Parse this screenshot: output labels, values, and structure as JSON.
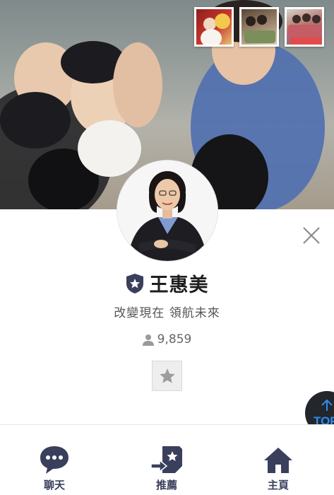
{
  "cover": {
    "photos": [
      {
        "icon": "event-photo-icon"
      },
      {
        "icon": "event-photo-icon"
      },
      {
        "icon": "event-photo-icon"
      }
    ]
  },
  "profile": {
    "name": "王惠美",
    "status_message": "改變現在 領航未來",
    "followers": "9,859",
    "badge_icon": "official-shield-icon"
  },
  "actions": {
    "close_icon": "close-icon",
    "favorite_icon": "star-icon"
  },
  "scroll_top": {
    "label": "TOP",
    "icon": "arrow-up-icon"
  },
  "tabs": [
    {
      "label": "聊天",
      "icon": "chat-bubble-icon"
    },
    {
      "label": "推薦",
      "icon": "share-recommend-icon"
    },
    {
      "label": "主頁",
      "icon": "home-icon"
    }
  ],
  "colors": {
    "icon_navy": "#3a3f5c",
    "top_button_bg": "#23262b",
    "top_button_fg": "#2d8cf0"
  }
}
